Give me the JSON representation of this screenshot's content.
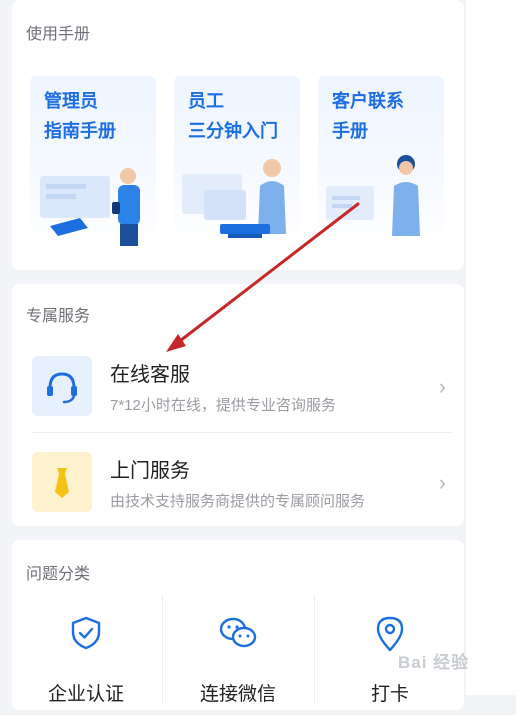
{
  "manuals": {
    "title": "使用手册",
    "items": [
      {
        "label": "管理员\n指南手册"
      },
      {
        "label": "员工\n三分钟入门"
      },
      {
        "label": "客户联系\n手册"
      }
    ]
  },
  "services": {
    "title": "专属服务",
    "items": [
      {
        "name": "在线客服",
        "desc": "7*12小时在线，提供专业咨询服务",
        "icon": "headset-icon",
        "icon_color": "#1d6fe0"
      },
      {
        "name": "上门服务",
        "desc": "由技术支持服务商提供的专属顾问服务",
        "icon": "tie-icon",
        "icon_color": "#f5c218"
      }
    ]
  },
  "categories": {
    "title": "问题分类",
    "items": [
      {
        "label": "企业认证",
        "icon": "shield-check-icon"
      },
      {
        "label": "连接微信",
        "icon": "wechat-icon"
      },
      {
        "label": "打卡",
        "icon": "location-pin-icon"
      }
    ]
  },
  "watermark": "Bai 经验",
  "colors": {
    "accent": "#1d6fe0",
    "annotation_arrow": "#c62828"
  }
}
